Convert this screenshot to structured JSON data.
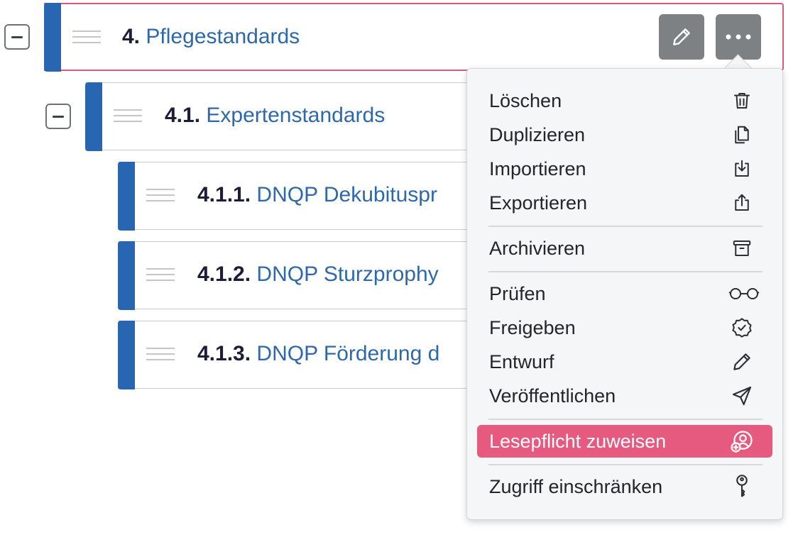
{
  "tree": {
    "rows": [
      {
        "number": "4.",
        "title": "Pflegestandards"
      },
      {
        "number": "4.1.",
        "title": "Expertenstandards"
      },
      {
        "number": "4.1.1.",
        "title": "DNQP Dekubituspr"
      },
      {
        "number": "4.1.2.",
        "title": "DNQP Sturzprophy"
      },
      {
        "number": "4.1.3.",
        "title": "DNQP Förderung d"
      }
    ]
  },
  "menu": {
    "items": [
      {
        "label": "Löschen",
        "icon": "trash-icon"
      },
      {
        "label": "Duplizieren",
        "icon": "duplicate-icon"
      },
      {
        "label": "Importieren",
        "icon": "import-icon"
      },
      {
        "label": "Exportieren",
        "icon": "export-icon"
      },
      {
        "label": "Archivieren",
        "icon": "archive-icon"
      },
      {
        "label": "Prüfen",
        "icon": "glasses-icon"
      },
      {
        "label": "Freigeben",
        "icon": "badge-check-icon"
      },
      {
        "label": "Entwurf",
        "icon": "pencil-icon"
      },
      {
        "label": "Veröffentlichen",
        "icon": "send-icon"
      },
      {
        "label": "Lesepflicht zuweisen",
        "icon": "assign-user-icon"
      },
      {
        "label": "Zugriff einschränken",
        "icon": "key-icon"
      }
    ]
  },
  "colors": {
    "accent_bar": "#2866b1",
    "active_border": "#e0577e",
    "highlight": "#e65a80",
    "icon_button": "#7d8184"
  }
}
